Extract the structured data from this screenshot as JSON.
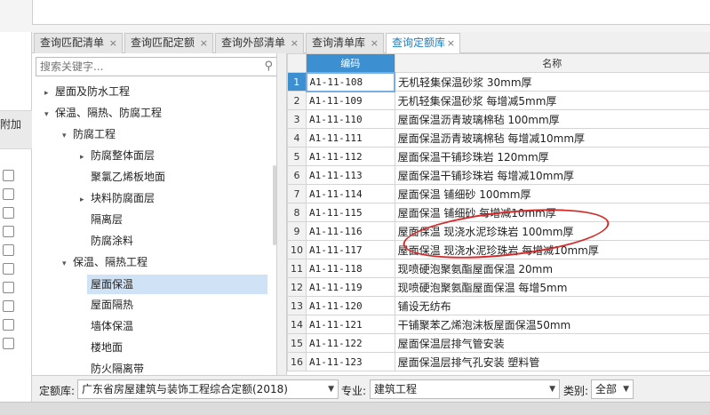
{
  "left_panel": {
    "header_label": "附加"
  },
  "tabs": [
    {
      "label": "查询匹配清单",
      "close": "×",
      "active": false
    },
    {
      "label": "查询匹配定额",
      "close": "×",
      "active": false
    },
    {
      "label": "查询外部清单",
      "close": "×",
      "active": false
    },
    {
      "label": "查询清单库",
      "close": "×",
      "active": false
    },
    {
      "label": "查询定额库",
      "close": "×",
      "active": true
    }
  ],
  "search": {
    "placeholder": "搜索关键字...",
    "icon": "search-icon"
  },
  "tree": [
    {
      "label": "屋面及防水工程",
      "arrow": "▸",
      "level": 0
    },
    {
      "label": "保温、隔热、防腐工程",
      "arrow": "▾",
      "level": 0
    },
    {
      "label": "防腐工程",
      "arrow": "▾",
      "level": 1
    },
    {
      "label": "防腐整体面层",
      "arrow": "▸",
      "level": 2
    },
    {
      "label": "聚氯乙烯板地面",
      "arrow": "",
      "level": 2
    },
    {
      "label": "块料防腐面层",
      "arrow": "▸",
      "level": 2
    },
    {
      "label": "隔离层",
      "arrow": "",
      "level": 2
    },
    {
      "label": "防腐涂料",
      "arrow": "",
      "level": 2
    },
    {
      "label": "保温、隔热工程",
      "arrow": "▾",
      "level": 1
    },
    {
      "label": "屋面保温",
      "arrow": "",
      "level": 2,
      "selected": true
    },
    {
      "label": "屋面隔热",
      "arrow": "",
      "level": 2
    },
    {
      "label": "墙体保温",
      "arrow": "",
      "level": 2
    },
    {
      "label": "楼地面",
      "arrow": "",
      "level": 2
    },
    {
      "label": "防火隔离带",
      "arrow": "",
      "level": 2
    }
  ],
  "grid": {
    "headers": {
      "row_no": "",
      "code": "编码",
      "name": "名称"
    },
    "rows": [
      {
        "no": "1",
        "code": "A1-11-108",
        "name": "无机轻集保温砂浆 30mm厚"
      },
      {
        "no": "2",
        "code": "A1-11-109",
        "name": "无机轻集保温砂浆 每增减5mm厚"
      },
      {
        "no": "3",
        "code": "A1-11-110",
        "name": "屋面保温沥青玻璃棉毡 100mm厚"
      },
      {
        "no": "4",
        "code": "A1-11-111",
        "name": "屋面保温沥青玻璃棉毡 每增减10mm厚"
      },
      {
        "no": "5",
        "code": "A1-11-112",
        "name": "屋面保温干铺珍珠岩 120mm厚"
      },
      {
        "no": "6",
        "code": "A1-11-113",
        "name": "屋面保温干铺珍珠岩 每增减10mm厚"
      },
      {
        "no": "7",
        "code": "A1-11-114",
        "name": "屋面保温 铺细砂 100mm厚"
      },
      {
        "no": "8",
        "code": "A1-11-115",
        "name": "屋面保温 铺细砂 每增减10mm厚"
      },
      {
        "no": "9",
        "code": "A1-11-116",
        "name": "屋面保温 现浇水泥珍珠岩 100mm厚"
      },
      {
        "no": "10",
        "code": "A1-11-117",
        "name": "屋面保温 现浇水泥珍珠岩 每增减10mm厚"
      },
      {
        "no": "11",
        "code": "A1-11-118",
        "name": "现喷硬泡聚氨酯屋面保温 20mm"
      },
      {
        "no": "12",
        "code": "A1-11-119",
        "name": "现喷硬泡聚氨酯屋面保温 每增5mm"
      },
      {
        "no": "13",
        "code": "A1-11-120",
        "name": "铺设无纺布"
      },
      {
        "no": "14",
        "code": "A1-11-121",
        "name": "干铺聚苯乙烯泡沫板屋面保温50mm"
      },
      {
        "no": "15",
        "code": "A1-11-122",
        "name": "屋面保温层排气管安装"
      },
      {
        "no": "16",
        "code": "A1-11-123",
        "name": "屋面保温层排气孔安装 塑料管"
      }
    ]
  },
  "bottom": {
    "quota_label": "定额库:",
    "quota_value": "广东省房屋建筑与装饰工程综合定额(2018)",
    "major_label": "专业:",
    "major_value": "建筑工程",
    "category_label": "类别:",
    "category_value": "全部"
  },
  "colors": {
    "accent": "#3c8fd0",
    "highlight": "#d42a2a",
    "tree_selected": "#cfe2f6"
  }
}
